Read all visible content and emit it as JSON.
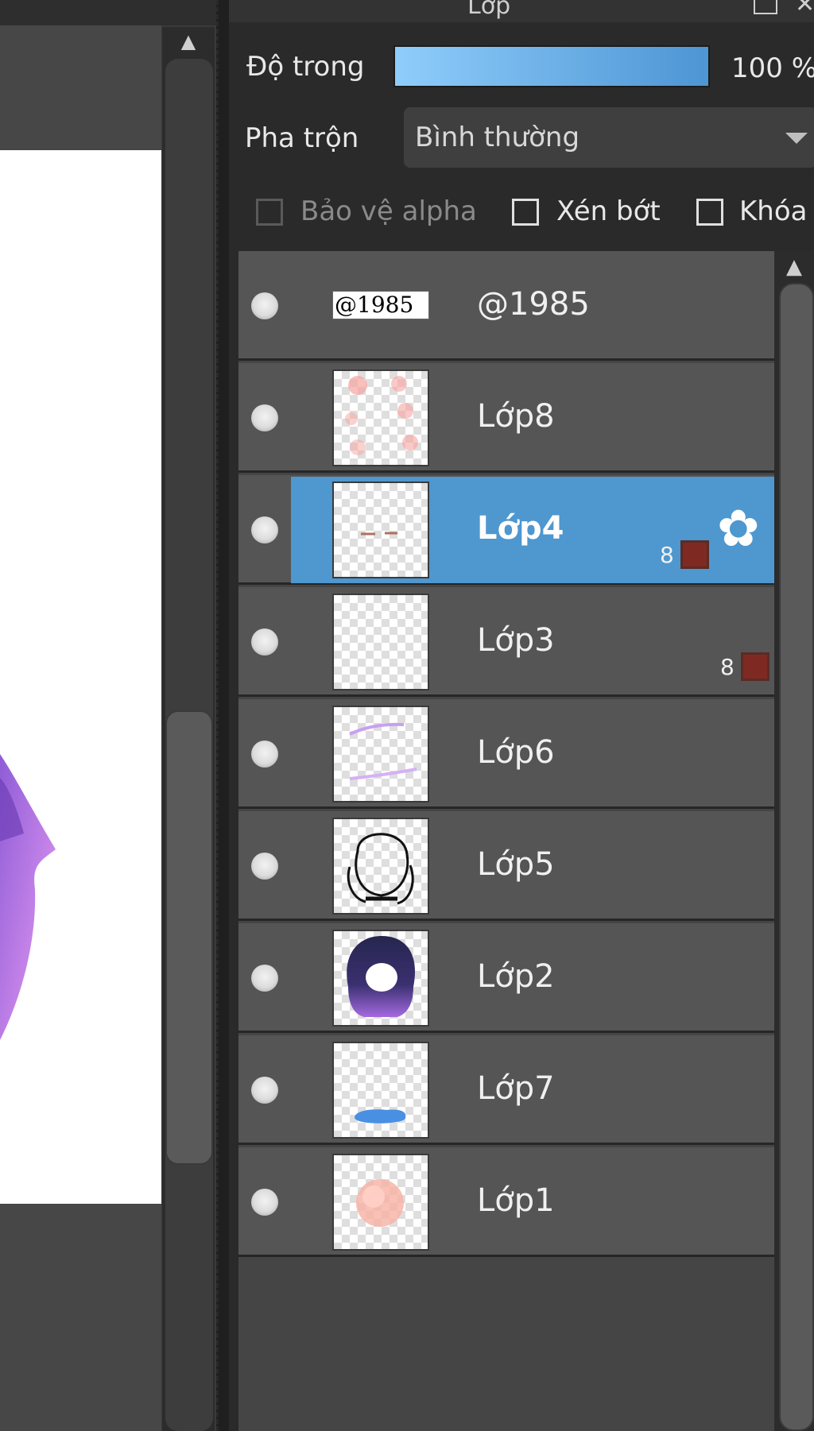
{
  "panel": {
    "title": "Lớp",
    "opacity_label": "Độ trong",
    "opacity_value": "100 %",
    "blend_label": "Pha trộn",
    "blend_value": "Bình thường",
    "checkboxes": [
      {
        "label": "Bảo vệ alpha",
        "checked": false,
        "enabled": false
      },
      {
        "label": "Xén bớt",
        "checked": false,
        "enabled": true
      },
      {
        "label": "Khóa",
        "checked": false,
        "enabled": true
      }
    ]
  },
  "layers": [
    {
      "name": "@1985",
      "thumb_text": "@1985",
      "selected": false
    },
    {
      "name": "Lớp8",
      "selected": false
    },
    {
      "name": "Lớp4",
      "selected": true,
      "badge": "8",
      "badge_color": "#7e2a22"
    },
    {
      "name": "Lớp3",
      "selected": false,
      "badge": "8",
      "badge_color": "#7e2a22"
    },
    {
      "name": "Lớp6",
      "selected": false
    },
    {
      "name": "Lớp5",
      "selected": false
    },
    {
      "name": "Lớp2",
      "selected": false
    },
    {
      "name": "Lớp7",
      "selected": false
    },
    {
      "name": "Lớp1",
      "selected": false
    }
  ],
  "colors": {
    "accent": "#4f97cf",
    "row_bg": "#555555",
    "badge": "#7e2a22"
  }
}
